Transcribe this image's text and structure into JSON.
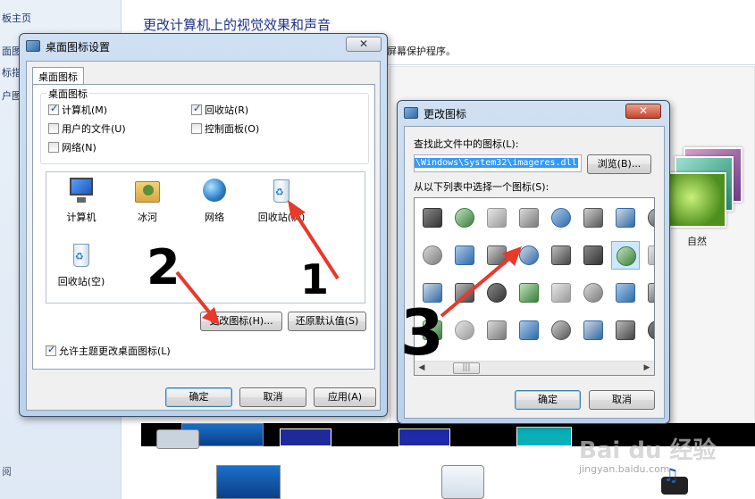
{
  "background": {
    "nav_items": [
      "板主页",
      "面图",
      "标指",
      "户图"
    ],
    "nav_bottom": "阅",
    "title": "更改计算机上的视觉效果和声音",
    "subtitle": "屏幕保护程序。",
    "theme_label": "自然",
    "watermark": "Bai du 经验",
    "watermark_url": "jingyan.baidu.com"
  },
  "desktop_dialog": {
    "title": "桌面图标设置",
    "tab": "桌面图标",
    "group_title": "桌面图标",
    "checkboxes": [
      {
        "label": "计算机(M)",
        "checked": true
      },
      {
        "label": "回收站(R)",
        "checked": true
      },
      {
        "label": "用户的文件(U)",
        "checked": false
      },
      {
        "label": "控制面板(O)",
        "checked": false
      },
      {
        "label": "网络(N)",
        "checked": false
      }
    ],
    "icons": [
      {
        "label": "计算机",
        "icon": "computer-icon"
      },
      {
        "label": "冰河",
        "icon": "user-folder-icon"
      },
      {
        "label": "网络",
        "icon": "network-icon"
      },
      {
        "label": "回收站(满)",
        "icon": "recycle-bin-full-icon"
      },
      {
        "label": "回收站(空)",
        "icon": "recycle-bin-empty-icon"
      }
    ],
    "change_icon_button": "更改图标(H)...",
    "restore_default_button": "还原默认值(S)",
    "allow_themes_label": "允许主题更改桌面图标(L)",
    "allow_themes_checked": true,
    "ok": "确定",
    "cancel": "取消",
    "apply": "应用(A)"
  },
  "change_icon_dialog": {
    "title": "更改图标",
    "search_label": "查找此文件中的图标(L):",
    "path_value": "\\Windows\\System32\\imageres.dll",
    "browse": "浏览(B)...",
    "list_label": "从以下列表中选择一个图标(S):",
    "ok": "确定",
    "cancel": "取消"
  },
  "annotations": {
    "step1": "1",
    "step2": "2",
    "step3": "3"
  },
  "colors": {
    "title_blue": "#1e3287",
    "arrow_red": "#e8392b",
    "selection_blue": "#3399ff"
  }
}
